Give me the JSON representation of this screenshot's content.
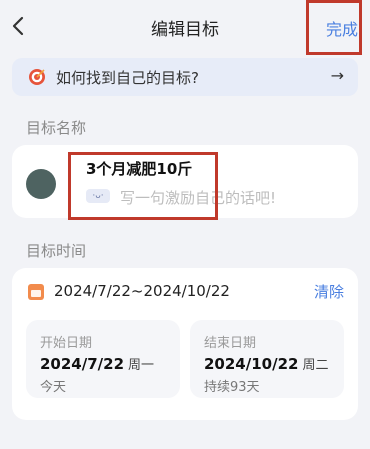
{
  "header": {
    "title": "编辑目标",
    "done_label": "完成"
  },
  "tip": {
    "text": "如何找到自己的目标?",
    "arrow": "→"
  },
  "name_section": {
    "label": "目标名称",
    "goal_name": "3个月减肥10斤",
    "motto_placeholder": "写一句激励自己的话吧!",
    "motto_icon_text": "·ᴗ·"
  },
  "time_section": {
    "label": "目标时间",
    "range": "2024/7/22~2024/10/22",
    "clear_label": "清除",
    "start": {
      "label": "开始日期",
      "date": "2024/7/22",
      "weekday": "周一",
      "sub": "今天"
    },
    "end": {
      "label": "结束日期",
      "date": "2024/10/22",
      "weekday": "周二",
      "sub": "持续93天"
    }
  },
  "colors": {
    "accent": "#4a7fe0",
    "highlight_box": "#c0392b",
    "avatar": "#4e6361"
  }
}
